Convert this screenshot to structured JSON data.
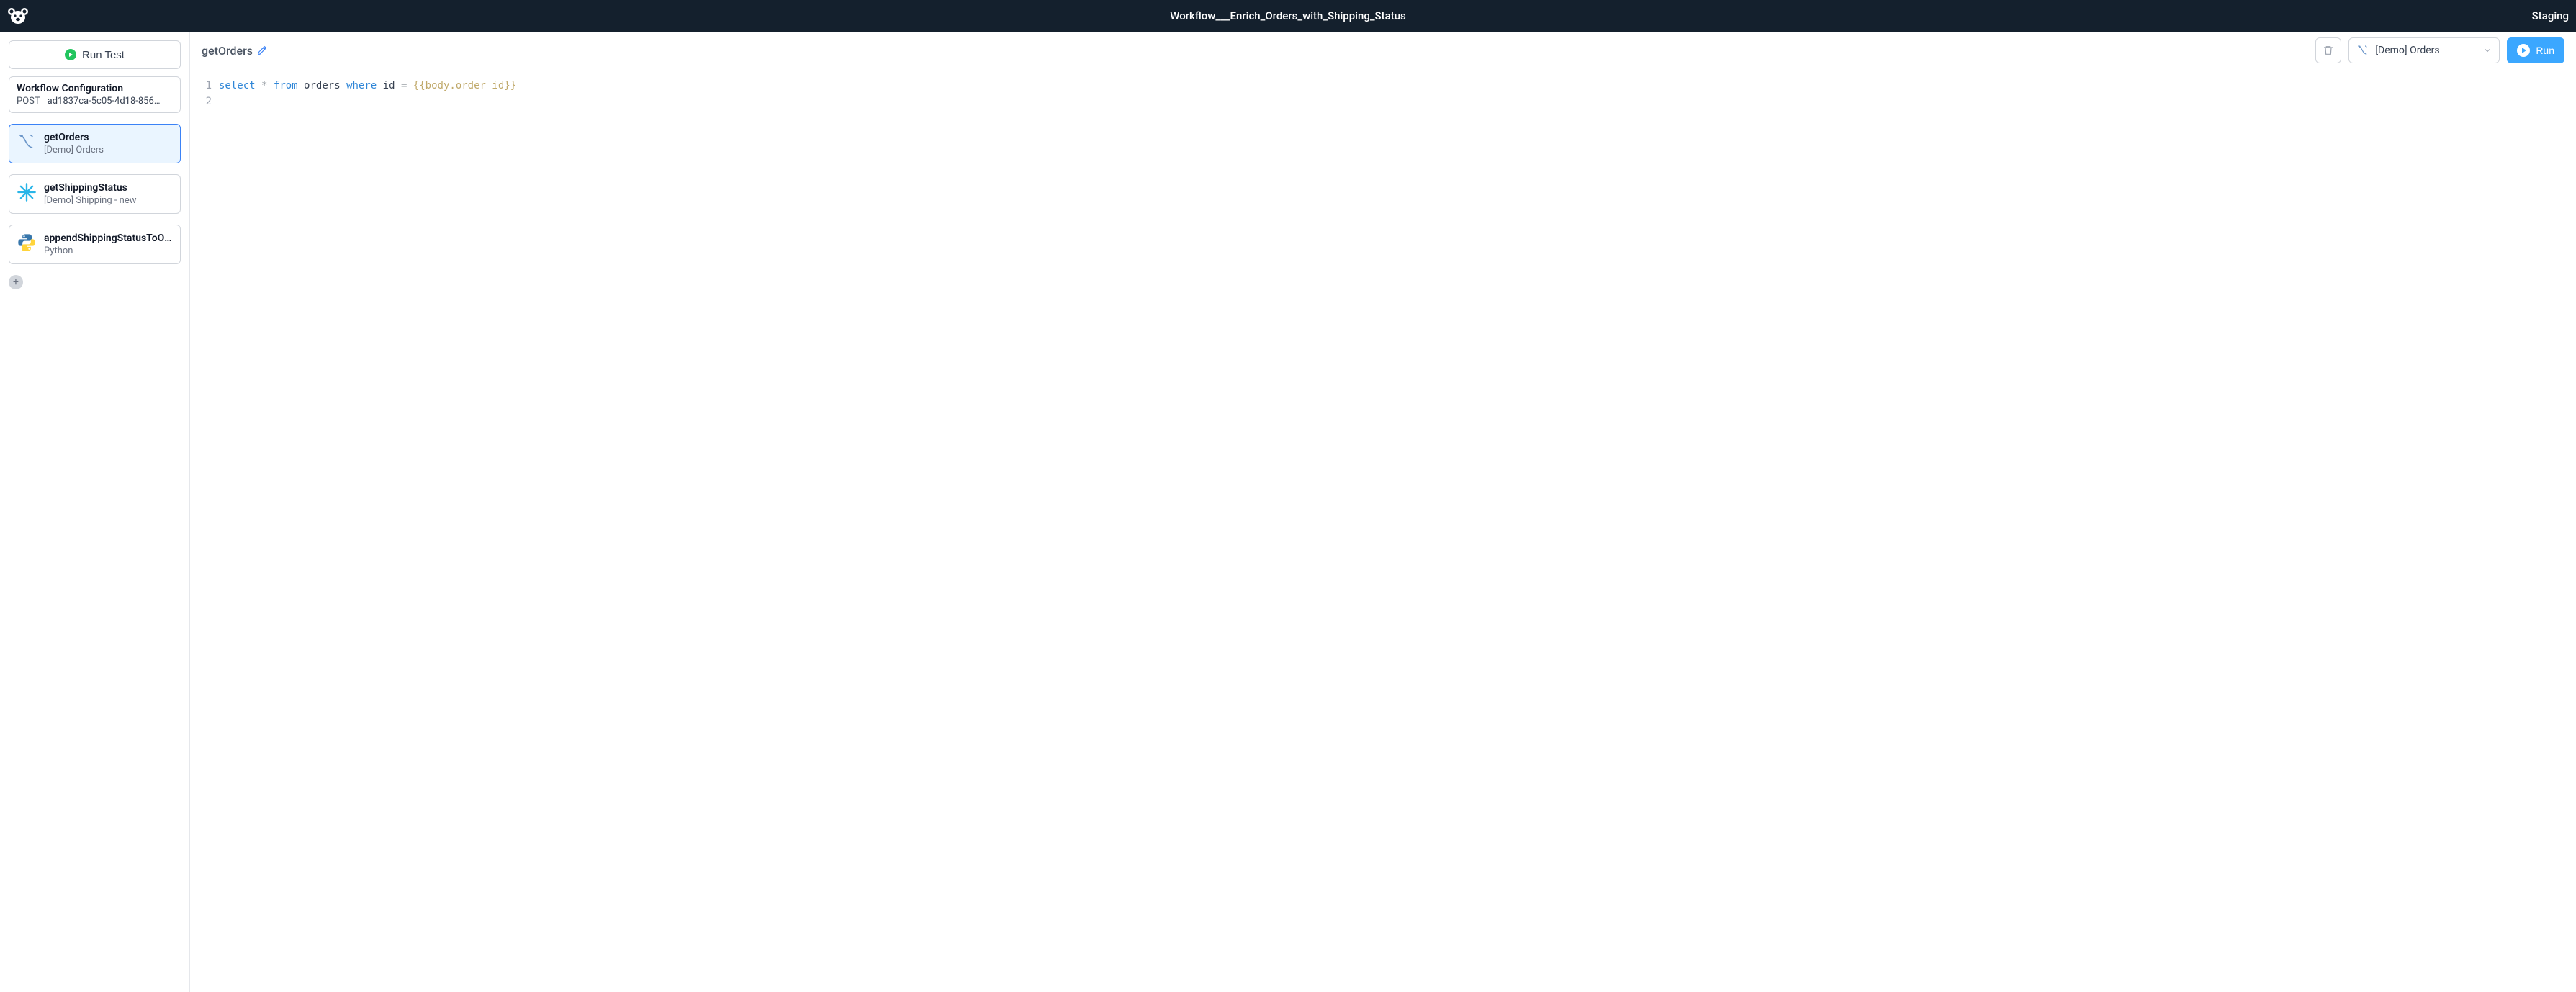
{
  "header": {
    "title": "Workflow___Enrich_Orders_with_Shipping_Status",
    "environment": "Staging"
  },
  "sidebar": {
    "run_test_label": "Run Test",
    "workflow_config": {
      "title": "Workflow Configuration",
      "method": "POST",
      "id": "ad1837ca-5c05-4d18-8562-…"
    },
    "nodes": [
      {
        "name": "getOrders",
        "subtitle": "[Demo] Orders",
        "icon": "mysql",
        "active": true
      },
      {
        "name": "getShippingStatus",
        "subtitle": "[Demo] Shipping - new",
        "icon": "snowflake",
        "active": false
      },
      {
        "name": "appendShippingStatusToOr…",
        "subtitle": "Python",
        "icon": "python",
        "active": false
      }
    ]
  },
  "editor": {
    "block_name": "getOrders",
    "resource_selected": "[Demo] Orders",
    "run_label": "Run",
    "code_lines": [
      {
        "n": "1",
        "tokens": [
          {
            "t": "select",
            "c": "kw"
          },
          {
            "t": " ",
            "c": ""
          },
          {
            "t": "*",
            "c": "op"
          },
          {
            "t": " ",
            "c": ""
          },
          {
            "t": "from",
            "c": "kw"
          },
          {
            "t": " ",
            "c": ""
          },
          {
            "t": "orders",
            "c": "id"
          },
          {
            "t": " ",
            "c": ""
          },
          {
            "t": "where",
            "c": "kw"
          },
          {
            "t": " ",
            "c": ""
          },
          {
            "t": "id",
            "c": "id"
          },
          {
            "t": " ",
            "c": ""
          },
          {
            "t": "=",
            "c": "op"
          },
          {
            "t": " ",
            "c": ""
          },
          {
            "t": "{{body.order_id}}",
            "c": "tmpl"
          }
        ]
      },
      {
        "n": "2",
        "tokens": []
      }
    ]
  }
}
